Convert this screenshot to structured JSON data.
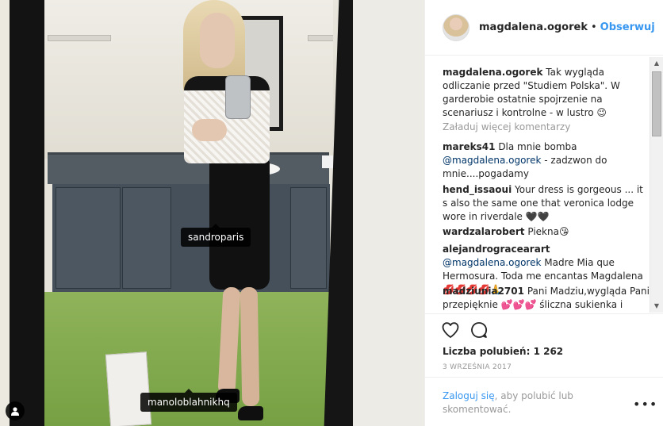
{
  "post": {
    "tags": [
      {
        "label": "sandroparis"
      },
      {
        "label": "manoloblahnikhq"
      }
    ]
  },
  "header": {
    "username": "magdalena.ogorek",
    "separator": "•",
    "follow_label": "Obserwuj"
  },
  "caption": {
    "username": "magdalena.ogorek",
    "text": "Tak wygląda odliczanie przed \"Studiem Polska\". W garderobie ostatnie spojrzenie na scenariusz i kontrolne - w lustro 😉"
  },
  "load_more_label": "Załaduj więcej komentarzy",
  "comments": [
    {
      "username": "mareks41",
      "text_before": "Dla mnie bomba",
      "mention": "@magdalena.ogorek",
      "text_after": "- zadzwon do mnie....pogadamy"
    },
    {
      "username": "hend_issaoui",
      "text": "Your dress is gorgeous ... it s also the same one that veronica lodge wore in riverdale 🖤🖤"
    },
    {
      "username": "wardzalarobert",
      "text": "Piekna😘"
    },
    {
      "username": "alejandrogracearart",
      "mention": "@magdalena.ogorek",
      "text_after": "Madre Mia que Hermosura. Toda me encantas Magdalena💋💋💋💋🙏"
    },
    {
      "username": "madziunia2701",
      "text": "Pani Madziu,wygląda Pani przepięknie 💕💕💕 śliczna sukienka i"
    }
  ],
  "scrollbar": {
    "up": "▲",
    "down": "▼"
  },
  "actions": {
    "likes_label": "Liczba polubień: 1 262",
    "date": "3 WRZEŚNIA 2017"
  },
  "login": {
    "link": "Zaloguj się",
    "text": ", aby polubić lub skomentować.",
    "more": "•••"
  },
  "colors": {
    "accent": "#3897f0",
    "mention": "#003569",
    "muted": "#999999"
  }
}
